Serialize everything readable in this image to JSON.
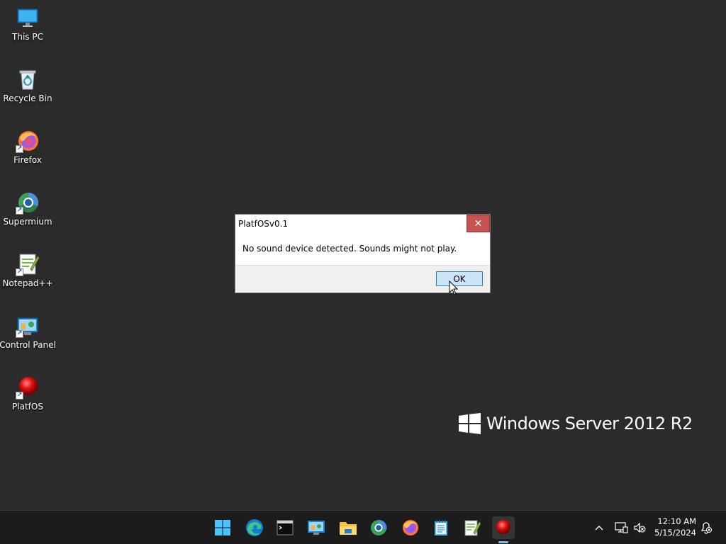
{
  "desktop": {
    "icons": [
      {
        "label": "This PC",
        "icon": "monitor-icon"
      },
      {
        "label": "Recycle Bin",
        "icon": "recycle-bin-icon"
      },
      {
        "label": "Firefox",
        "icon": "firefox-icon"
      },
      {
        "label": "Supermium",
        "icon": "supermium-icon"
      },
      {
        "label": "Notepad++",
        "icon": "notepad-plus-plus-icon"
      },
      {
        "label": "Control Panel",
        "icon": "control-panel-icon"
      },
      {
        "label": "PlatfOS",
        "icon": "platfos-icon"
      }
    ],
    "watermark": "Windows Server 2012 R2"
  },
  "dialog": {
    "title": "PlatfOSv0.1",
    "close_label": "✕",
    "message": "No sound device detected. Sounds might not play.",
    "ok_label": "OK"
  },
  "taskbar": {
    "pinned": [
      {
        "name": "start-button",
        "icon": "windows-logo-icon"
      },
      {
        "name": "edge",
        "icon": "edge-icon"
      },
      {
        "name": "terminal",
        "icon": "terminal-icon"
      },
      {
        "name": "control-panel",
        "icon": "control-panel-icon"
      },
      {
        "name": "file-explorer",
        "icon": "folder-icon"
      },
      {
        "name": "supermium",
        "icon": "supermium-icon"
      },
      {
        "name": "firefox",
        "icon": "firefox-icon"
      },
      {
        "name": "notepad",
        "icon": "notepad-icon"
      },
      {
        "name": "notepad-plus-plus",
        "icon": "notepad-plus-plus-icon"
      },
      {
        "name": "platfos",
        "icon": "platfos-icon",
        "active": true
      }
    ],
    "tray": {
      "chevron": "chevron-up-icon",
      "network": "network-icon",
      "volume": "volume-muted-icon",
      "notifications": "notification-icon"
    },
    "clock": {
      "time": "12:10 AM",
      "date": "5/15/2024"
    }
  },
  "colors": {
    "desktop_bg": "#2b2b2b",
    "taskbar_bg": "#1c1c1c",
    "close_button": "#c75050",
    "ok_button": "#cce4f7"
  }
}
